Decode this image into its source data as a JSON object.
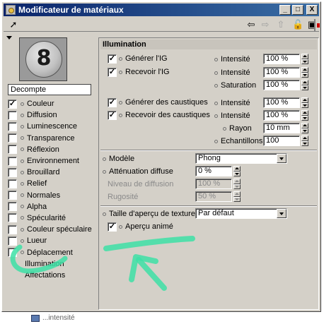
{
  "window": {
    "title": "Modificateur de matériaux"
  },
  "titlebar_buttons": {
    "minimize": "_",
    "maximize": "□",
    "close": "X"
  },
  "material": {
    "name": "Decompte",
    "preview_glyph": "8"
  },
  "channels": [
    {
      "label": "Couleur",
      "checked": true,
      "checkbox": true
    },
    {
      "label": "Diffusion",
      "checked": false,
      "checkbox": true
    },
    {
      "label": "Luminescence",
      "checked": false,
      "checkbox": true
    },
    {
      "label": "Transparence",
      "checked": false,
      "checkbox": true
    },
    {
      "label": "Réflexion",
      "checked": false,
      "checkbox": true
    },
    {
      "label": "Environnement",
      "checked": false,
      "checkbox": true
    },
    {
      "label": "Brouillard",
      "checked": false,
      "checkbox": true
    },
    {
      "label": "Relief",
      "checked": false,
      "checkbox": true
    },
    {
      "label": "Normales",
      "checked": false,
      "checkbox": true
    },
    {
      "label": "Alpha",
      "checked": false,
      "checkbox": true
    },
    {
      "label": "Spécularité",
      "checked": false,
      "checkbox": true
    },
    {
      "label": "Couleur spéculaire",
      "checked": false,
      "checkbox": true
    },
    {
      "label": "Lueur",
      "checked": false,
      "checkbox": true
    },
    {
      "label": "Déplacement",
      "checked": false,
      "checkbox": true
    },
    {
      "label": "Illumination",
      "checked": false,
      "checkbox": false
    },
    {
      "label": "Affectations",
      "checked": false,
      "checkbox": false
    }
  ],
  "illumination": {
    "title": "Illumination",
    "generer_ig": {
      "label": "Générer l'IG",
      "checked": true
    },
    "recevoir_ig": {
      "label": "Recevoir l'IG",
      "checked": true
    },
    "generer_caustiques": {
      "label": "Générer des caustiques",
      "checked": true
    },
    "recevoir_caustiques": {
      "label": "Recevoir des caustiques",
      "checked": true
    },
    "gi_intensite_1": {
      "label": "Intensité",
      "value": "100 %"
    },
    "gi_intensite_2": {
      "label": "Intensité",
      "value": "100 %"
    },
    "saturation": {
      "label": "Saturation",
      "value": "100 %"
    },
    "c_intensite_1": {
      "label": "Intensité",
      "value": "100 %"
    },
    "c_intensite_2": {
      "label": "Intensité",
      "value": "100 %"
    },
    "rayon": {
      "label": "Rayon",
      "value": "10 mm"
    },
    "echantillons": {
      "label": "Echantillons",
      "value": "100"
    },
    "modele": {
      "label": "Modèle",
      "value": "Phong"
    },
    "attenuation": {
      "label": "Atténuation diffuse",
      "value": "0 %"
    },
    "niveau": {
      "label": "Niveau de diffusion",
      "value": "100 %"
    },
    "rugosite": {
      "label": "Rugosité",
      "value": "50 %"
    },
    "taille_apercu": {
      "label": "Taille d'aperçu de texture",
      "value": "Par défaut"
    },
    "apercu_anime": {
      "label": "Aperçu animé",
      "checked": true
    }
  },
  "colors": {
    "titlebar_start": "#0a246a",
    "titlebar_end": "#3a6ea5",
    "panel": "#d4d0c8",
    "annotation": "#3de0a6"
  },
  "taskbar": {
    "label": "...intensité"
  },
  "icons": [
    "back-arrow-icon",
    "forward-arrow-icon",
    "up-arrow-icon",
    "lock-icon",
    "new-window-icon",
    "pointer-icon"
  ]
}
